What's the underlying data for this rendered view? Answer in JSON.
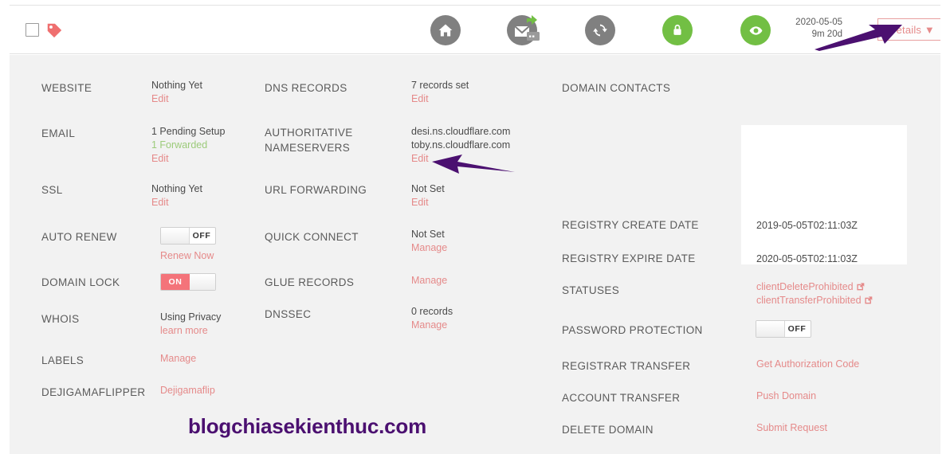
{
  "header": {
    "checkbox_checked": false,
    "tag_icon": "tag-icon",
    "icons": [
      {
        "name": "home-icon",
        "glyph": "home",
        "color": "#808080"
      },
      {
        "name": "email-forward-icon",
        "glyph": "mail",
        "color": "#808080"
      },
      {
        "name": "sync-icon",
        "glyph": "refresh",
        "color": "#808080"
      },
      {
        "name": "lock-icon",
        "glyph": "lock",
        "color": "#72bf44"
      },
      {
        "name": "privacy-eye-icon",
        "glyph": "eye",
        "color": "#72bf44"
      }
    ],
    "expiry_date": "2020-05-05",
    "expiry_remaining": "9m 20d",
    "details_label": "Details ▼"
  },
  "colors": {
    "accent_link": "#e58a8a",
    "toggle_on": "#f4737a",
    "green": "#72bf44",
    "green_text": "#9ccb7a",
    "panel_bg": "#f2f2f2",
    "watermark": "#4b1070"
  },
  "column1": [
    {
      "label": "WEBSITE",
      "value": "Nothing Yet",
      "link": "Edit"
    },
    {
      "label": "EMAIL",
      "value": "1 Pending Setup",
      "subvalue": "1 Forwarded",
      "link": "Edit"
    },
    {
      "label": "SSL",
      "value": "Nothing Yet",
      "link": "Edit"
    },
    {
      "label": "AUTO RENEW",
      "toggle": "OFF",
      "link": "Renew Now"
    },
    {
      "label": "DOMAIN LOCK",
      "toggle": "ON"
    },
    {
      "label": "WHOIS",
      "value": "Using Privacy",
      "link": "learn more"
    },
    {
      "label": "LABELS",
      "link": "Manage"
    },
    {
      "label": "DEJIGAMAFLIPPER",
      "link": "Dejigamaflip"
    }
  ],
  "column2": [
    {
      "label": "DNS RECORDS",
      "value": "7 records set",
      "link": "Edit"
    },
    {
      "label": "AUTHORITATIVE NAMESERVERS",
      "label_line1": "AUTHORITATIVE",
      "label_line2": "NAMESERVERS",
      "value": "desi.ns.cloudflare.com",
      "value2": "toby.ns.cloudflare.com",
      "link": "Edit"
    },
    {
      "label": "URL FORWARDING",
      "value": "Not Set",
      "link": "Edit"
    },
    {
      "label": "QUICK CONNECT",
      "value": "Not Set",
      "link": "Manage"
    },
    {
      "label": "GLUE RECORDS",
      "link": "Manage"
    },
    {
      "label": "DNSSEC",
      "value": "0 records",
      "link": "Manage"
    }
  ],
  "column3": [
    {
      "label": "DOMAIN CONTACTS"
    },
    {
      "label": "REGISTRY CREATE DATE",
      "value": "2019-05-05T02:11:03Z"
    },
    {
      "label": "REGISTRY EXPIRE DATE",
      "value": "2020-05-05T02:11:03Z"
    },
    {
      "label": "STATUSES",
      "status1": "clientDeleteProhibited",
      "status2": "clientTransferProhibited"
    },
    {
      "label": "PASSWORD PROTECTION",
      "toggle": "OFF"
    },
    {
      "label": "REGISTRAR TRANSFER",
      "link": "Get Authorization Code"
    },
    {
      "label": "ACCOUNT TRANSFER",
      "link": "Push Domain"
    },
    {
      "label": "DELETE DOMAIN",
      "link": "Submit Request"
    }
  ],
  "watermark": "blogchiasekienthuc.com"
}
